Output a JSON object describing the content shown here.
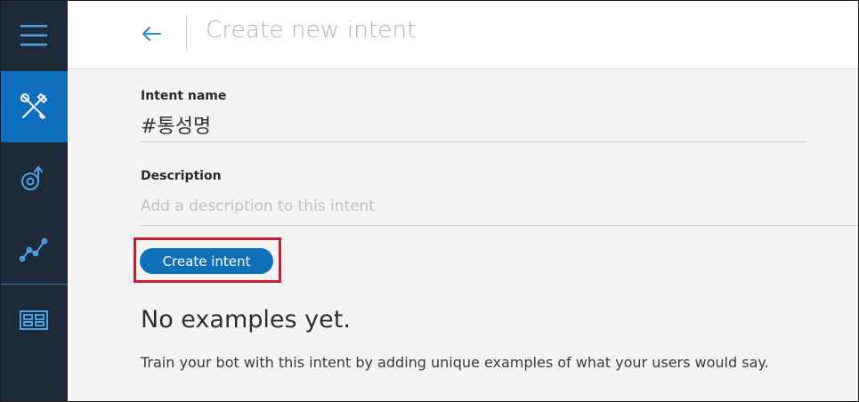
{
  "sidebar": {
    "items": [
      {
        "icon": "menu-icon",
        "active": false
      },
      {
        "icon": "tools-icon",
        "active": true
      },
      {
        "icon": "deploy-icon",
        "active": false
      },
      {
        "icon": "analytics-icon",
        "active": false
      },
      {
        "icon": "dashboard-icon",
        "active": false
      }
    ],
    "colors": {
      "background": "#1e2a38",
      "active": "#0f6fbe",
      "icon": "#4aa3e8"
    }
  },
  "header": {
    "back_icon": "arrow-left-icon",
    "title": "Create new intent"
  },
  "form": {
    "intent_name_label": "Intent name",
    "intent_name_value": "#통성명",
    "description_label": "Description",
    "description_placeholder": "Add a description to this intent",
    "create_button_label": "Create intent",
    "create_button_color": "#0d70b8",
    "highlight_color": "#c8202a"
  },
  "examples": {
    "empty_title": "No examples yet.",
    "empty_description": "Train your bot with this intent by adding unique examples of what your users would say."
  }
}
